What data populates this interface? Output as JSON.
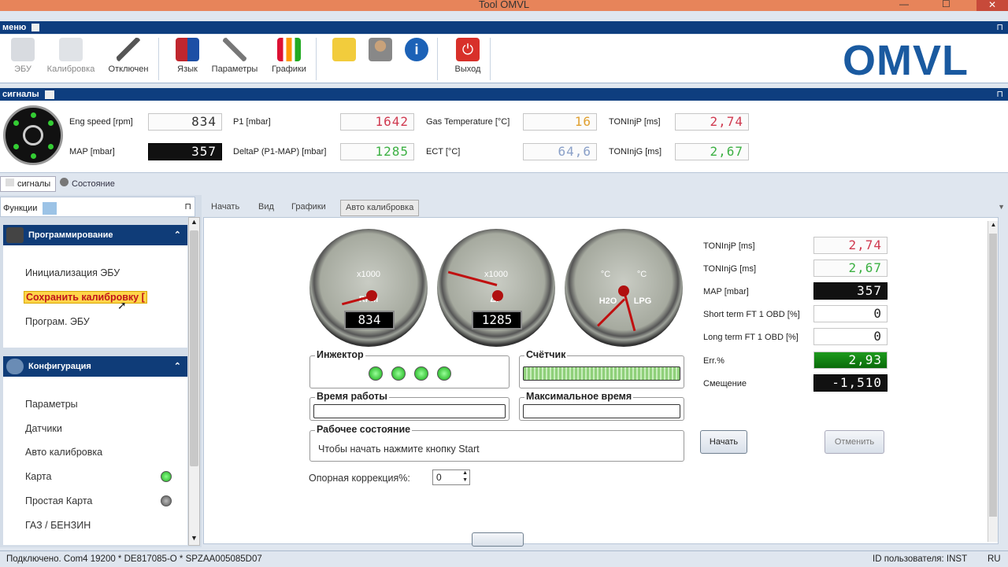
{
  "app": {
    "title": "Tool OMVL",
    "logo": "OMVL"
  },
  "menubar": {
    "label": "меню"
  },
  "ribbon": {
    "buttons": [
      {
        "label": "ЭБУ",
        "icon": "ecu-icon",
        "enabled": false
      },
      {
        "label": "Калибровка",
        "icon": "calibration-icon",
        "enabled": false
      },
      {
        "label": "Отключен",
        "icon": "disconnected-icon",
        "enabled": true
      },
      {
        "label": "Язык",
        "icon": "language-flags-icon",
        "enabled": true
      },
      {
        "label": "Параметры",
        "icon": "wrench-icon",
        "enabled": true
      },
      {
        "label": "Графики",
        "icon": "bar-chart-icon",
        "enabled": true
      },
      {
        "label": "",
        "icon": "notepad-icon",
        "enabled": true
      },
      {
        "label": "",
        "icon": "user-icon",
        "enabled": true
      },
      {
        "label": "",
        "icon": "info-icon",
        "enabled": true
      },
      {
        "label": "Выход",
        "icon": "power-icon",
        "enabled": true
      }
    ]
  },
  "signals_bar": {
    "label": "сигналы"
  },
  "signals": [
    {
      "label": "Eng speed [rpm]",
      "value": "834",
      "color": "#333333"
    },
    {
      "label": "MAP [mbar]",
      "value": "357",
      "color": "#ffffff"
    },
    {
      "label": "P1 [mbar]",
      "value": "1642",
      "color": "#d03a50"
    },
    {
      "label": "DeltaP (P1-MAP) [mbar]",
      "value": "1285",
      "color": "#3cb043"
    },
    {
      "label": "Gas Temperature [°C]",
      "value": "16",
      "color": "#e0a030"
    },
    {
      "label": "ECT [°C]",
      "value": "64,6",
      "color": "#8aa0c8"
    },
    {
      "label": "TONInjP [ms]",
      "value": "2,74",
      "color": "#d03a50"
    },
    {
      "label": "TONInjG [ms]",
      "value": "2,67",
      "color": "#3cb043"
    }
  ],
  "view_tabs": [
    "сигналы",
    "Состояние"
  ],
  "left_panel": {
    "title": "Функции",
    "groups": [
      {
        "title": "Программирование",
        "items": [
          "Инициализация ЭБУ",
          "Сохранить калибровку [",
          "Програм. ЭБУ"
        ]
      },
      {
        "title": "Конфигурация",
        "items": [
          "Параметры",
          "Датчики",
          "Авто калибровка",
          "Карта",
          "Простая Карта",
          "ГАЗ / БЕНЗИН"
        ]
      }
    ]
  },
  "main_tabs": [
    "Начать",
    "Вид",
    "Графики",
    "Авто калибровка"
  ],
  "gauges": {
    "rpm": {
      "unit": "x1000",
      "label": "RPM",
      "display": "834",
      "ticks": [
        "0",
        "1",
        "2",
        "3",
        "4",
        "5",
        "6",
        "7",
        "8"
      ]
    },
    "dp": {
      "unit": "x1000",
      "label": "ΔP",
      "display": "1285",
      "ticks": [
        "0",
        "1",
        "2",
        "3",
        "4",
        "5"
      ]
    },
    "temp": {
      "left_unit": "°C",
      "right_unit": "°C",
      "left_label": "H2O",
      "right_label": "LPG",
      "ticks": [
        "20",
        "40",
        "60",
        "80",
        "100",
        "120",
        "140"
      ]
    }
  },
  "panels": {
    "injector": {
      "title": "Инжектор"
    },
    "counter": {
      "title": "Счётчик"
    },
    "run_time": {
      "title": "Время работы"
    },
    "max_time": {
      "title": "Максимальное время"
    },
    "state": {
      "title": "Рабочее состояние",
      "text": "Чтобы начать нажмите кнопку Start"
    }
  },
  "ref_correction": {
    "label": "Опорная коррекция%:",
    "value": "0"
  },
  "right_values": [
    {
      "label": "TONInjP [ms]",
      "value": "2,74",
      "color": "#d03a50"
    },
    {
      "label": "TONInjG [ms]",
      "value": "2,67",
      "color": "#3cb043"
    },
    {
      "label": "MAP [mbar]",
      "value": "357",
      "color": "#ffffff"
    },
    {
      "label": "Short term FT 1 OBD [%]",
      "value": "0",
      "color": "#222222"
    },
    {
      "label": "Long term FT 1 OBD [%]",
      "value": "0",
      "color": "#222222"
    },
    {
      "label": "Err.%",
      "value": "2,93",
      "color": "#ffffff"
    },
    {
      "label": "Смещение",
      "value": "-1,510",
      "color": "#ffffff"
    }
  ],
  "buttons": {
    "start": "Начать",
    "cancel": "Отменить"
  },
  "statusbar": {
    "left": "Подключено. Com4 19200 * DE817085-O * SPZAA005085D07",
    "user": "ID пользователя: INST",
    "lang": "RU"
  }
}
